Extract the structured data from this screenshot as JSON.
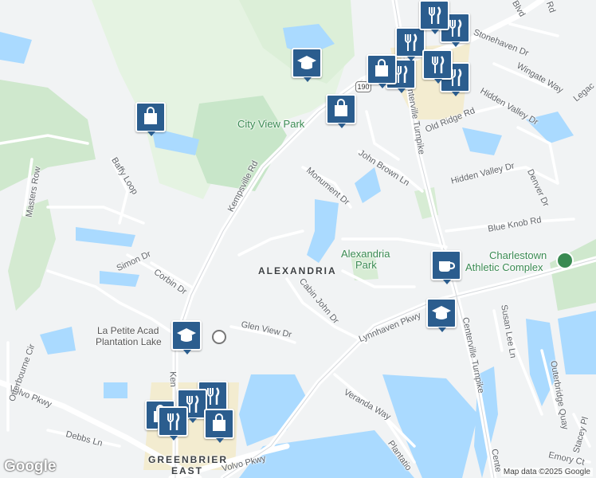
{
  "streets": {
    "kempsville": "Kempsville Rd",
    "centerville": "Centerville Turnpike",
    "centerville_south": "Centerville Turnpike",
    "lynnhaven": "Lynnhaven Pkwy",
    "volvo_west": "Volvo Pkwy",
    "volvo_south": "Volvo Pkwy",
    "monument": "Monument Dr",
    "john_brown": "John Brown Ln",
    "cabin_john": "Cabin John Dr",
    "glen_view": "Glen View Dr",
    "corbin": "Corbin Dr",
    "simon": "Simon Dr",
    "baffy": "Baffy Loop",
    "masters": "Masters Row",
    "veranda": "Veranda Way",
    "debbs": "Debbs Ln",
    "otterbourne": "Otterbourne Cir",
    "blue_knob": "Blue Knob Rd",
    "old_ridge": "Old Ridge Rd",
    "hidden_valley": "Hidden Valley Dr",
    "hidden_valley_2": "Hidden Valley Dr",
    "denver": "Denver Dr",
    "stonehaven": "Stonehaven Dr",
    "wingate": "Wingate Way",
    "susan_lee": "Susan Lee Ln",
    "outerbridge": "Outerbridge Quay",
    "stacey": "Stacey Pl",
    "emory": "Emory Ct",
    "legacy": "Legac",
    "blvd": "Blvd",
    "rd_top": "Rd",
    "plantation": "Plantatio",
    "kempsville_south": "Ken",
    "centerville_bottom": "Cente"
  },
  "parks": {
    "city_view": "City View Park",
    "alexandria_park_line1": "Alexandria",
    "alexandria_park_line2": "Park",
    "charlestown_line1": "Charlestown",
    "charlestown_line2": "Athletic Complex"
  },
  "areas": {
    "alexandria": "ALEXANDRIA",
    "greenbrier": "GREENBRIER",
    "east": "EAST"
  },
  "pois": {
    "la_petite_line1": "La Petite Acad",
    "la_petite_line2": "Plantation Lake"
  },
  "route_shield": "190",
  "markers": [
    {
      "icon": "bag-icon",
      "type": "shopping"
    },
    {
      "icon": "graduation-cap-icon",
      "type": "school"
    },
    {
      "icon": "bag-icon",
      "type": "shopping"
    },
    {
      "icon": "fork-knife-icon",
      "type": "restaurant"
    },
    {
      "icon": "coffee-icon",
      "type": "cafe"
    },
    {
      "icon": "graduation-cap-icon",
      "type": "school"
    },
    {
      "icon": "graduation-cap-icon",
      "type": "school"
    }
  ],
  "attribution": "Map data ©2025 Google",
  "logo": "Google",
  "colors": {
    "marker": "#2b5d8e",
    "water": "#aadaff",
    "park": "#c8e6c9",
    "road": "#ffffff"
  }
}
